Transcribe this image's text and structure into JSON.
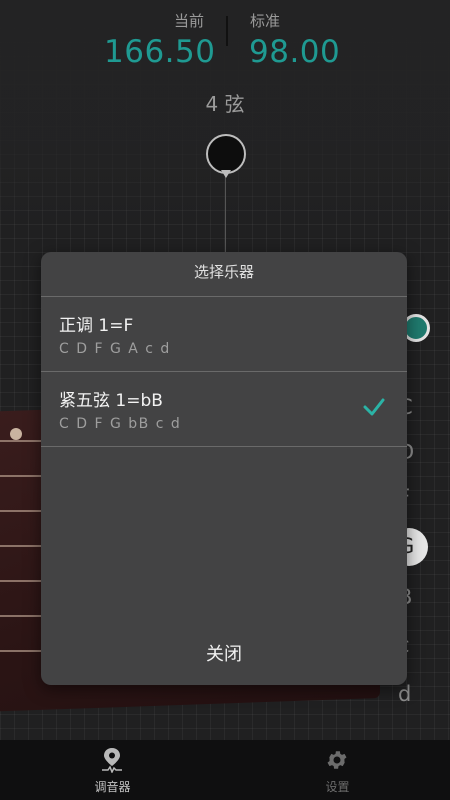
{
  "readout": {
    "current_label": "当前",
    "current_value": "166.50",
    "target_label": "标准",
    "target_value": "98.00"
  },
  "string_name": "4 弦",
  "side_notes": [
    "C",
    "D",
    "F",
    "G",
    "B",
    "c",
    "d"
  ],
  "dialog": {
    "title": "选择乐器",
    "options": [
      {
        "name": "正调 1=F",
        "notes": "C D F G A c d",
        "selected": false
      },
      {
        "name": "紧五弦 1=bB",
        "notes": "C D F G bB c d",
        "selected": true
      }
    ],
    "close_label": "关闭"
  },
  "nav": {
    "items": [
      {
        "label": "调音器",
        "icon": "tuner-pin-icon",
        "active": true
      },
      {
        "label": "设置",
        "icon": "gear-icon",
        "active": false
      }
    ]
  },
  "colors": {
    "accent": "#1f9a92",
    "check": "#2bb3a6",
    "dialog_bg": "#434344"
  }
}
